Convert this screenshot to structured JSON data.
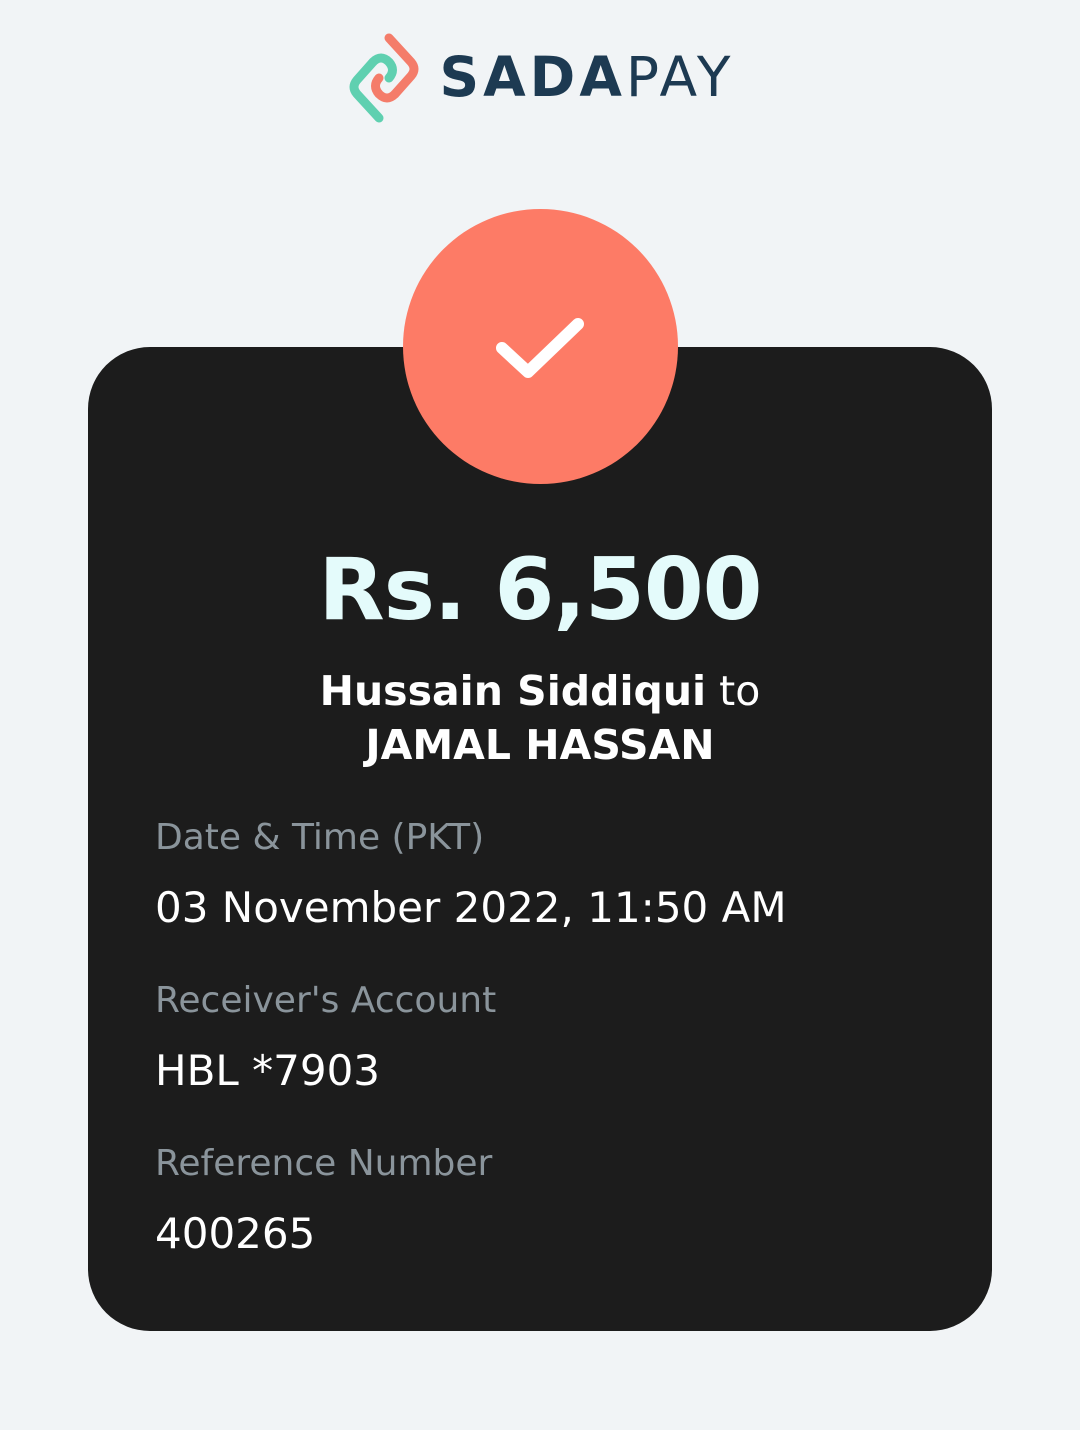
{
  "brand": {
    "icon": "sadapay-logo-icon",
    "name_bold": "SADA",
    "name_light": "PAY",
    "colors": [
      "#5fd0b0",
      "#fd7b66",
      "#1d3a52"
    ]
  },
  "status": {
    "icon": "checkmark-icon",
    "color": "#fd7b66"
  },
  "receipt": {
    "amount": "Rs. 6,500",
    "sender": "Hussain Siddiqui",
    "connector": "to",
    "receiver": "JAMAL HASSAN",
    "fields": [
      {
        "label": "Date & Time (PKT)",
        "value": "03 November 2022, 11:50 AM"
      },
      {
        "label": "Receiver's Account",
        "value": "HBL *7903"
      },
      {
        "label": "Reference Number",
        "value": "400265"
      }
    ]
  }
}
